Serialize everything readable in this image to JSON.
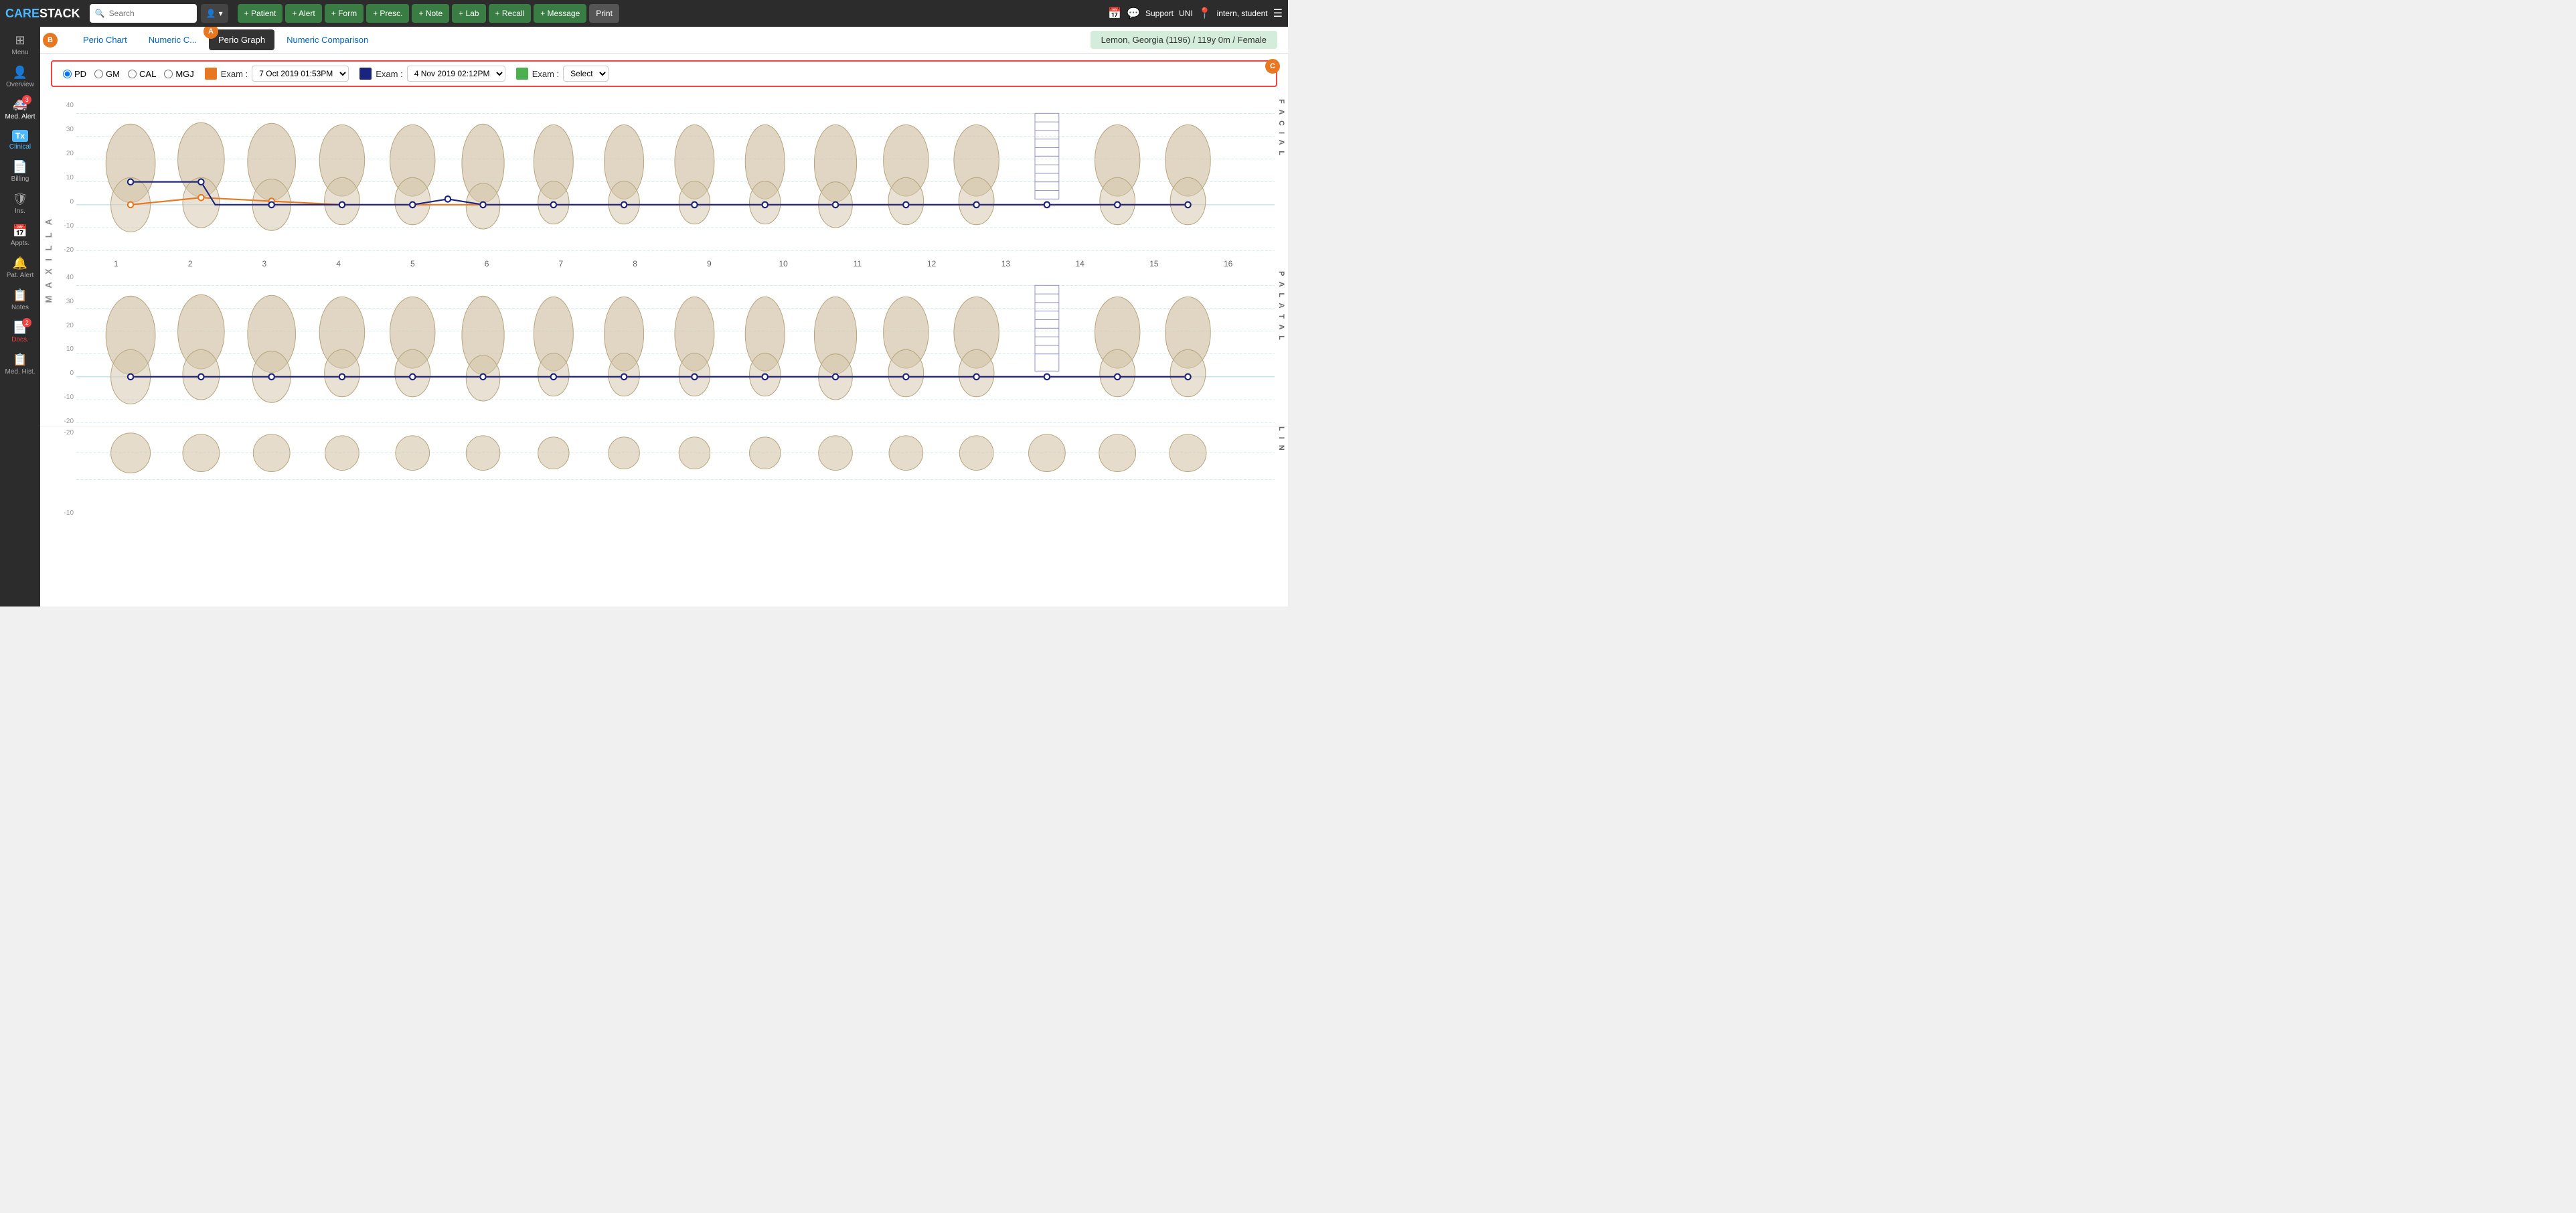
{
  "app": {
    "logo_care": "CARE",
    "logo_stack": "STACK"
  },
  "topnav": {
    "search_placeholder": "Search",
    "user_icon": "👤",
    "buttons": [
      {
        "label": "+ Patient",
        "key": "patient"
      },
      {
        "label": "+ Alert",
        "key": "alert"
      },
      {
        "label": "+ Form",
        "key": "form"
      },
      {
        "label": "+ Presc.",
        "key": "presc"
      },
      {
        "label": "+ Note",
        "key": "note"
      },
      {
        "label": "+ Lab",
        "key": "lab"
      },
      {
        "label": "+ Recall",
        "key": "recall"
      },
      {
        "label": "+ Message",
        "key": "message"
      },
      {
        "label": "Print",
        "key": "print"
      }
    ],
    "support": "Support",
    "uni": "UNI",
    "user": "intern, student",
    "calendar_icon": "📅",
    "chat_icon": "💬",
    "location_icon": "📍"
  },
  "sidebar": {
    "items": [
      {
        "label": "Menu",
        "icon": "⊞",
        "key": "menu",
        "badge": null
      },
      {
        "label": "Overview",
        "icon": "👤",
        "key": "overview",
        "badge": null
      },
      {
        "label": "Med. Alert",
        "icon": "🚑",
        "key": "med-alert",
        "badge": "3"
      },
      {
        "label": "Clinical",
        "icon": "Tx",
        "key": "clinical",
        "badge": null
      },
      {
        "label": "Billing",
        "icon": "📄",
        "key": "billing",
        "badge": null
      },
      {
        "label": "Ins.",
        "icon": "🛡",
        "key": "ins",
        "badge": null
      },
      {
        "label": "Appts.",
        "icon": "📅",
        "key": "appts",
        "badge": null
      },
      {
        "label": "Pat. Alert",
        "icon": "🔔",
        "key": "pat-alert",
        "badge": null
      },
      {
        "label": "Notes",
        "icon": "📋",
        "key": "notes",
        "badge": null
      },
      {
        "label": "Docs.",
        "icon": "📄",
        "key": "docs",
        "badge": "2"
      },
      {
        "label": "Med. Hist.",
        "icon": "📋",
        "key": "med-hist",
        "badge": null
      }
    ]
  },
  "subtabs": {
    "tabs": [
      {
        "label": "Perio Chart",
        "key": "perio-chart",
        "active": false
      },
      {
        "label": "Numeric C...",
        "key": "numeric-c",
        "active": false
      },
      {
        "label": "Perio Graph",
        "key": "perio-graph",
        "active": true
      },
      {
        "label": "Numeric Comparison",
        "key": "numeric-comparison",
        "active": false
      }
    ],
    "tour_a": "A",
    "tour_b": "B",
    "tour_c": "C"
  },
  "patient_banner": "Lemon, Georgia (1196) / 119y 0m / Female",
  "controls": {
    "radio_options": [
      {
        "label": "PD",
        "value": "PD",
        "checked": true
      },
      {
        "label": "GM",
        "value": "GM",
        "checked": false
      },
      {
        "label": "CAL",
        "value": "CAL",
        "checked": false
      },
      {
        "label": "MGJ",
        "value": "MGJ",
        "checked": false
      }
    ],
    "exam1": {
      "color": "#e87722",
      "label": "Exam :",
      "value": "7 Oct 2019 01:53PM"
    },
    "exam2": {
      "color": "#1a237e",
      "label": "Exam :",
      "value": "4 Nov 2019 02:12PM"
    },
    "exam3": {
      "color": "#4caf50",
      "label": "Exam :",
      "value": "Select"
    }
  },
  "graph": {
    "maxilla_label": "M A X I L L A",
    "facial_label": "F A C I A L",
    "palatal_label": "P A L A T A L",
    "lingual_label": "L I N",
    "y_values_top": [
      40,
      30,
      20,
      10,
      0,
      -10,
      -20
    ],
    "y_values_bottom": [
      40,
      30,
      20,
      10,
      0,
      -10,
      -20
    ],
    "tooth_numbers_upper": [
      1,
      2,
      3,
      4,
      5,
      6,
      7,
      8,
      9,
      10,
      11,
      12,
      13,
      14,
      15,
      16
    ]
  }
}
